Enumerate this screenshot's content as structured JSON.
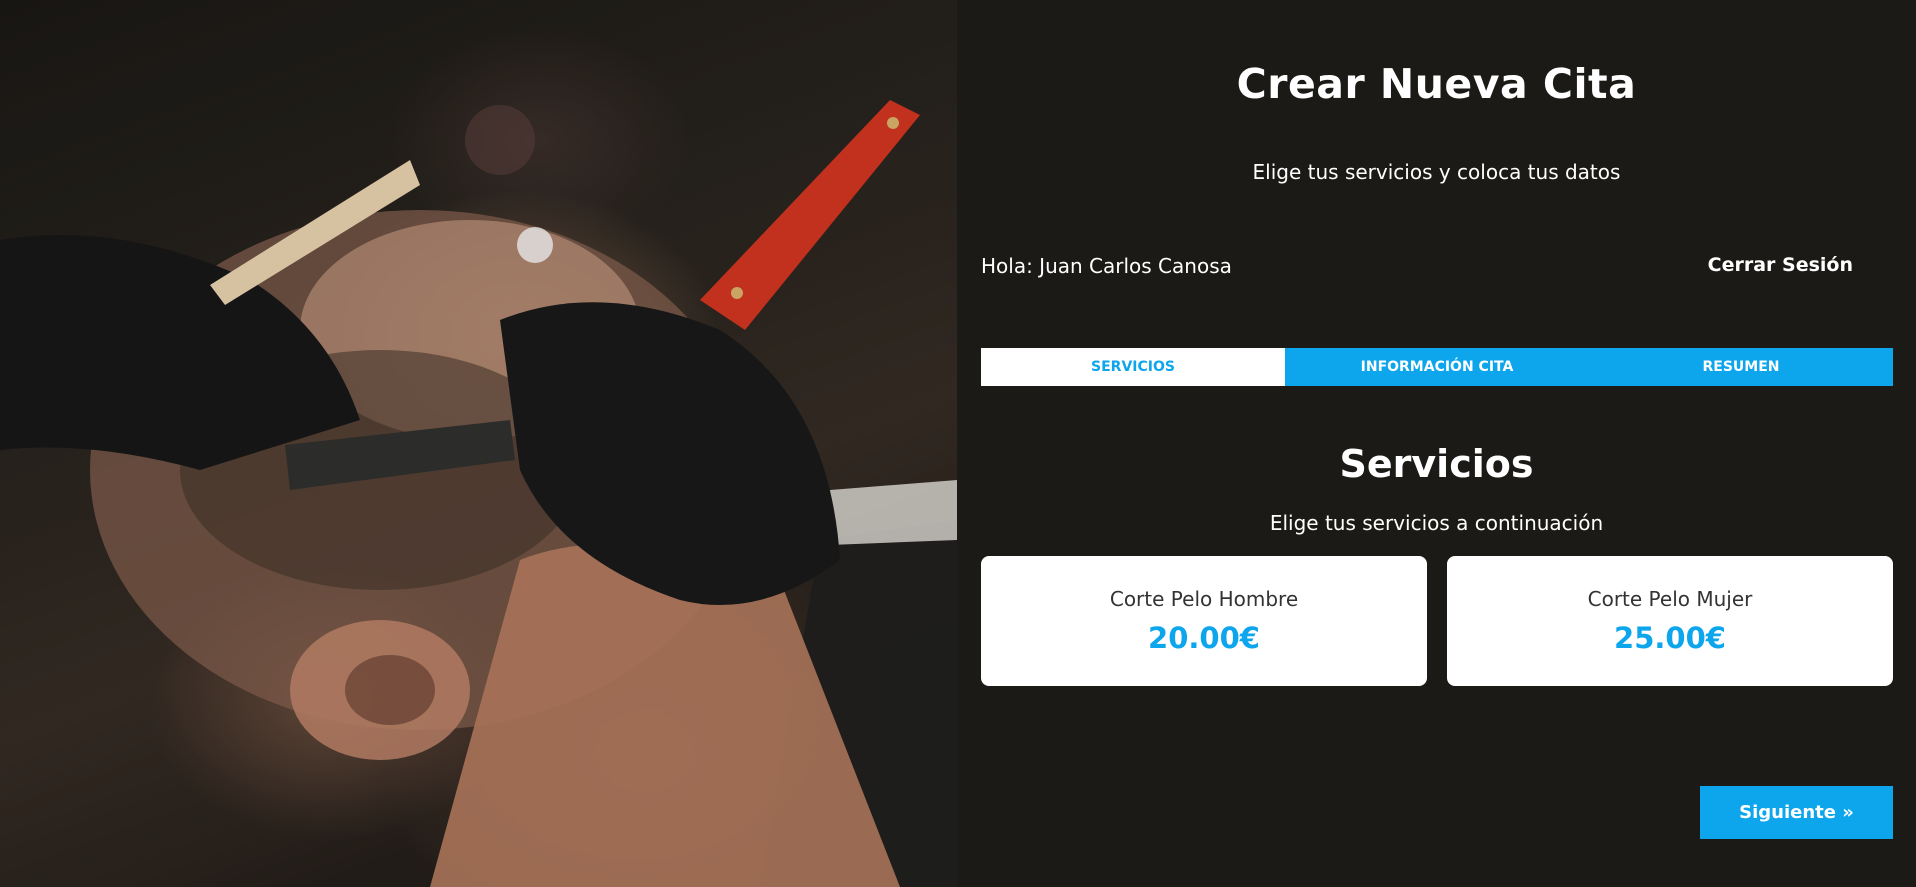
{
  "header": {
    "title": "Crear Nueva Cita",
    "subtitle": "Elige tus servicios y coloca tus datos"
  },
  "user": {
    "greeting": "Hola: Juan Carlos Canosa",
    "logout_label": "Cerrar Sesión"
  },
  "tabs": [
    {
      "label": "SERVICIOS",
      "active": true
    },
    {
      "label": "INFORMACIÓN CITA",
      "active": false
    },
    {
      "label": "RESUMEN",
      "active": false
    }
  ],
  "services_section": {
    "title": "Servicios",
    "description": "Elige tus servicios a continuación",
    "items": [
      {
        "name": "Corte Pelo Hombre",
        "price": "20.00€"
      },
      {
        "name": "Corte Pelo Mujer",
        "price": "25.00€"
      }
    ]
  },
  "navigation": {
    "next_label": "Siguiente »"
  },
  "colors": {
    "accent": "#0da6ed",
    "background": "#1b1a16",
    "card": "#ffffff"
  }
}
